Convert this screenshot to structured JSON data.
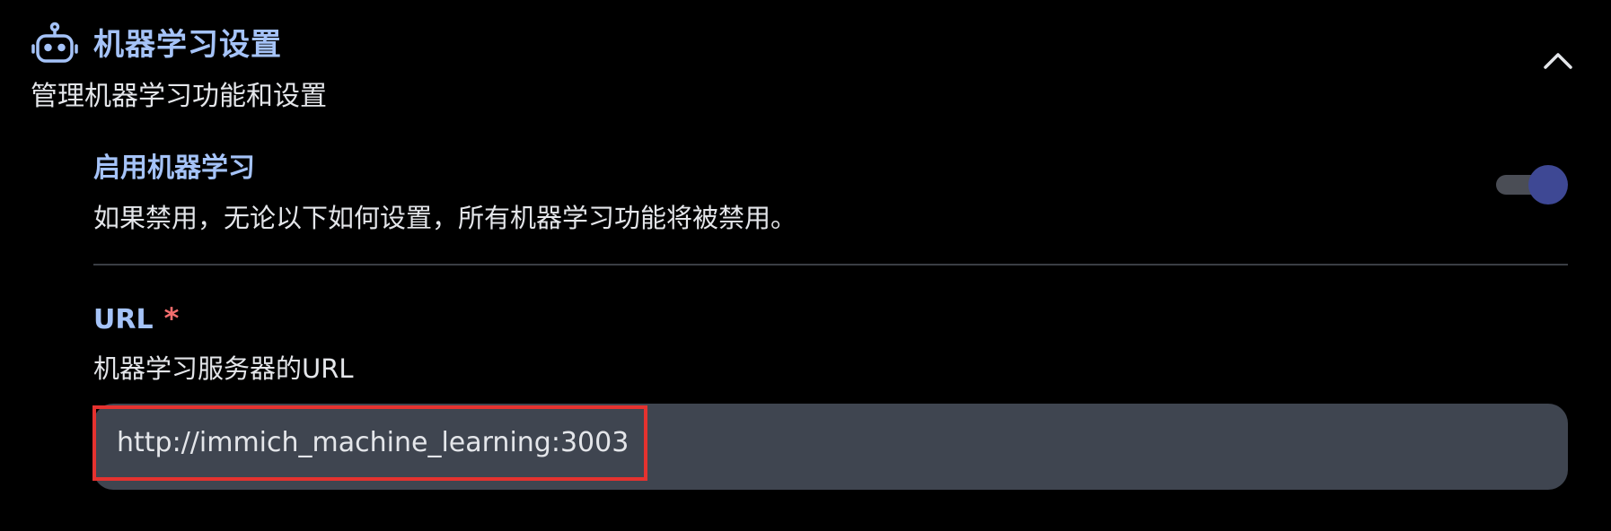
{
  "section": {
    "title": "机器学习设置",
    "subtitle": "管理机器学习功能和设置",
    "icon": "robot-icon",
    "collapse_icon": "chevron-up-icon"
  },
  "enable_ml": {
    "title": "启用机器学习",
    "description": "如果禁用，无论以下如何设置，所有机器学习功能将被禁用。",
    "enabled": true
  },
  "url": {
    "label": "URL",
    "required_mark": "*",
    "description": "机器学习服务器的URL",
    "value": "http://immich_machine_learning:3003"
  },
  "colors": {
    "accent": "#a5c3f8",
    "required": "#f26d6d",
    "toggle_on": "#3e4894",
    "input_bg": "#3f4550",
    "highlight": "#e5322f"
  }
}
